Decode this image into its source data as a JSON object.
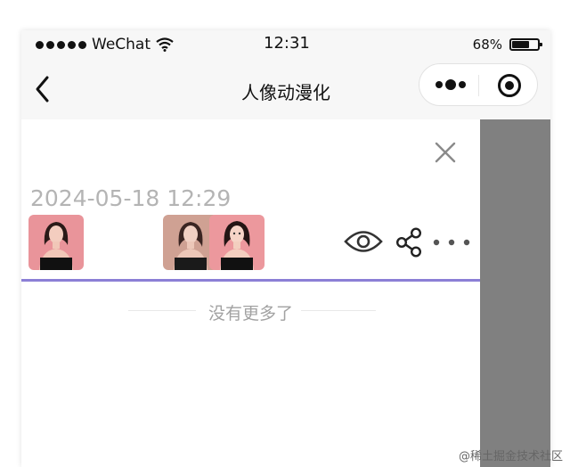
{
  "status_bar": {
    "carrier": "WeChat",
    "time": "12:31",
    "battery_percent": 68,
    "battery_label": "68%"
  },
  "nav": {
    "title": "人像动漫化"
  },
  "record": {
    "datetime": "2024-05-18 12:29",
    "thumbnails": [
      "portrait-original",
      "portrait-before",
      "portrait-after"
    ]
  },
  "list": {
    "end_text": "没有更多了"
  },
  "watermark": "@稀土掘金技术社区",
  "colors": {
    "divider": "#8b7fd6",
    "side_panel": "#808080",
    "thumb_bg": "#e9949a"
  }
}
